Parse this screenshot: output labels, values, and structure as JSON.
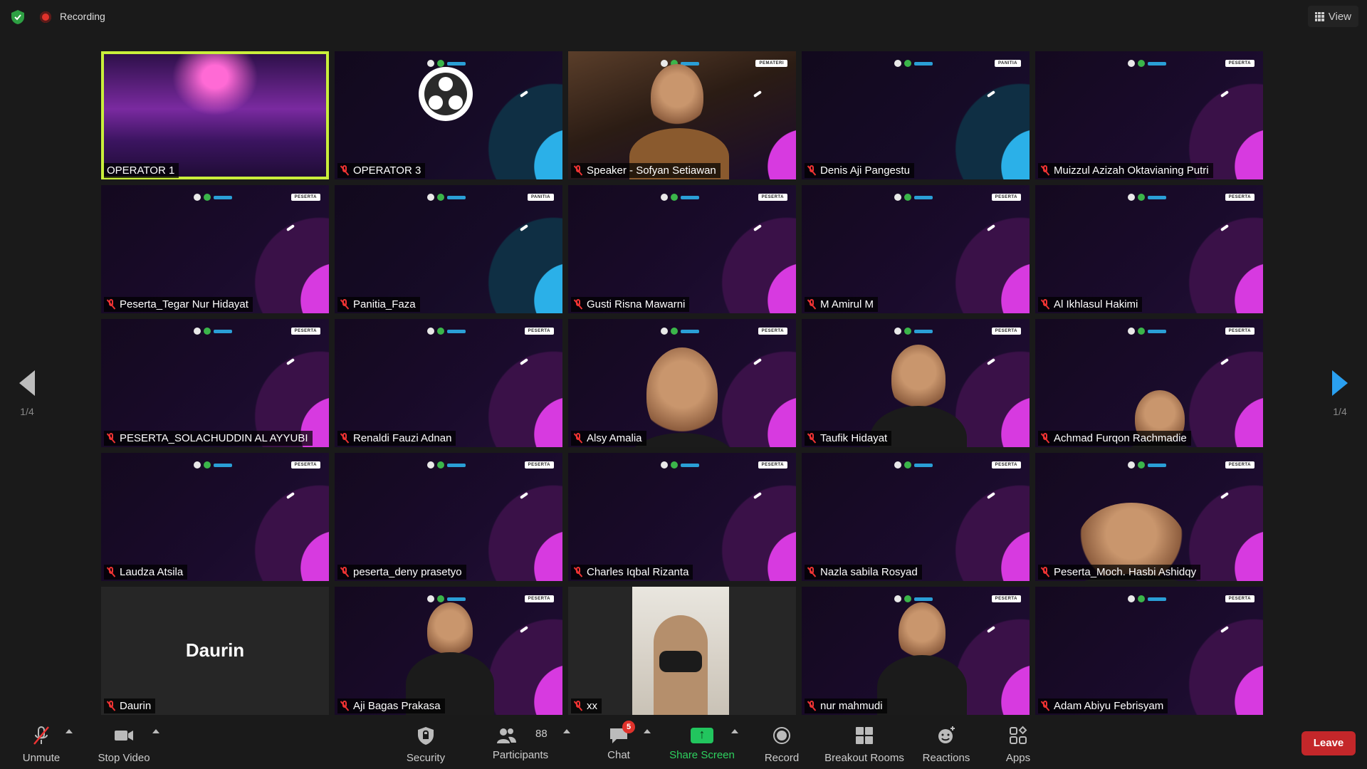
{
  "topbar": {
    "recording_label": "Recording",
    "view_label": "View",
    "shield_color": "#2ea043"
  },
  "pager": {
    "left_page": "1/4",
    "right_page": "1/4"
  },
  "tiles": [
    {
      "name": "OPERATOR 1",
      "kind": "stage",
      "active": true
    },
    {
      "name": "OPERATOR 3",
      "kind": "obs"
    },
    {
      "name": "Speaker - Sofyan Setiawan",
      "kind": "cam",
      "badge": "PEMATERI"
    },
    {
      "name": "Denis Aji Pangestu",
      "kind": "space-blue",
      "badge": "PANITIA"
    },
    {
      "name": "Muizzul Azizah Oktavianing Putri",
      "kind": "space",
      "badge": "PESERTA"
    },
    {
      "name": "Peserta_Tegar Nur Hidayat",
      "kind": "space",
      "badge": "PESERTA"
    },
    {
      "name": "Panitia_Faza",
      "kind": "space-blue",
      "badge": "PANITIA"
    },
    {
      "name": "Gusti Risna Mawarni",
      "kind": "space",
      "badge": "PESERTA"
    },
    {
      "name": "M Amirul M",
      "kind": "space",
      "badge": "PESERTA"
    },
    {
      "name": "Al Ikhlasul Hakimi",
      "kind": "space",
      "badge": "PESERTA"
    },
    {
      "name": "PESERTA_SOLACHUDDIN AL AYYUBI",
      "kind": "space",
      "badge": "PESERTA"
    },
    {
      "name": "Renaldi Fauzi Adnan",
      "kind": "space",
      "badge": "PESERTA"
    },
    {
      "name": "Alsy Amalia",
      "kind": "space-face",
      "badge": "PESERTA"
    },
    {
      "name": "Taufik Hidayat",
      "kind": "space-face",
      "badge": "PESERTA"
    },
    {
      "name": "Achmad Furqon Rachmadie",
      "kind": "space-face",
      "badge": "PESERTA"
    },
    {
      "name": "Laudza Atsila",
      "kind": "space",
      "badge": "PESERTA"
    },
    {
      "name": "peserta_deny prasetyo",
      "kind": "space",
      "badge": "PESERTA"
    },
    {
      "name": "Charles Iqbal Rizanta",
      "kind": "space",
      "badge": "PESERTA"
    },
    {
      "name": "Nazla sabila Rosyad",
      "kind": "space",
      "badge": "PESERTA"
    },
    {
      "name": "Peserta_Moch. Hasbi Ashidqy",
      "kind": "space-face",
      "badge": "PESERTA"
    },
    {
      "name": "Daurin",
      "kind": "blank",
      "center": "Daurin"
    },
    {
      "name": "Aji Bagas Prakasa",
      "kind": "space-face",
      "badge": "PESERTA"
    },
    {
      "name": "xx",
      "kind": "photo"
    },
    {
      "name": "nur mahmudi",
      "kind": "space-face",
      "badge": "PESERTA"
    },
    {
      "name": "Adam Abiyu Febrisyam",
      "kind": "space",
      "badge": "PESERTA"
    }
  ],
  "toolbar": {
    "unmute_label": "Unmute",
    "stop_video_label": "Stop Video",
    "security_label": "Security",
    "participants_label": "Participants",
    "participants_count": "88",
    "chat_label": "Chat",
    "chat_badge": "5",
    "share_label": "Share Screen",
    "record_label": "Record",
    "breakout_label": "Breakout Rooms",
    "reactions_label": "Reactions",
    "apps_label": "Apps",
    "leave_label": "Leave"
  }
}
